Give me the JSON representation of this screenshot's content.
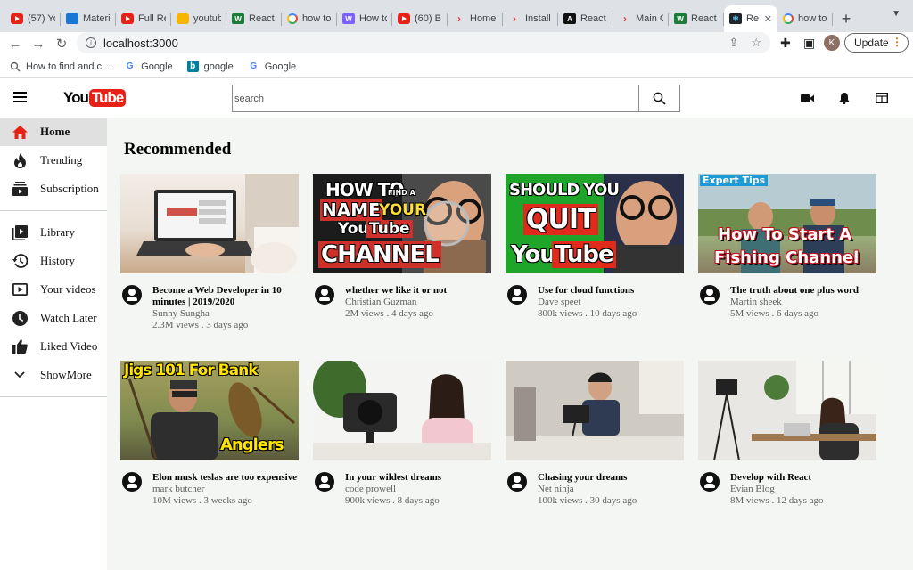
{
  "browser": {
    "tabs": [
      {
        "label": "(57) Yo",
        "icon": "youtube-favicon"
      },
      {
        "label": "Materi",
        "icon": "mui-favicon"
      },
      {
        "label": "Full Re",
        "icon": "youtube-favicon"
      },
      {
        "label": "youtub",
        "icon": "xyz-favicon"
      },
      {
        "label": "React",
        "icon": "w3-favicon"
      },
      {
        "label": "how to",
        "icon": "google-favicon"
      },
      {
        "label": "How to",
        "icon": "how-favicon"
      },
      {
        "label": "(60) B",
        "icon": "youtube-favicon"
      },
      {
        "label": "Home",
        "icon": "arrow-favicon"
      },
      {
        "label": "Install",
        "icon": "arrow-favicon"
      },
      {
        "label": "React",
        "icon": "dark-favicon"
      },
      {
        "label": "Main C",
        "icon": "arrow-favicon"
      },
      {
        "label": "React",
        "icon": "w3-favicon"
      },
      {
        "label": "Re",
        "icon": "react-favicon",
        "active": true
      },
      {
        "label": "how to",
        "icon": "google-favicon"
      }
    ],
    "url": "localhost:3000",
    "update_label": "Update",
    "profile_initial": "K",
    "bookmarks": [
      {
        "label": "How to find and c...",
        "icon": "search-icon"
      },
      {
        "label": "Google",
        "icon": "google-icon"
      },
      {
        "label": "google",
        "icon": "bing-icon"
      },
      {
        "label": "Google",
        "icon": "google-icon"
      }
    ]
  },
  "header": {
    "logo_you": "You",
    "logo_tube": "Tube",
    "search_placeholder": "search"
  },
  "sidebar": {
    "items": [
      {
        "label": "Home",
        "icon": "home-icon",
        "active": true
      },
      {
        "label": "Trending",
        "icon": "flame-icon"
      },
      {
        "label": "Subscription",
        "icon": "subscriptions-icon"
      },
      {
        "label": "Library",
        "icon": "library-icon"
      },
      {
        "label": "History",
        "icon": "history-icon"
      },
      {
        "label": "Your videos",
        "icon": "your-videos-icon"
      },
      {
        "label": "Watch Later",
        "icon": "watch-later-icon"
      },
      {
        "label": "Liked Video",
        "icon": "thumb-up-icon"
      },
      {
        "label": "ShowMore",
        "icon": "chevron-down-icon"
      }
    ]
  },
  "main": {
    "heading": "Recommended",
    "videos": [
      {
        "title": "Become a Web Developer in 10 minutes | 2019/2020",
        "channel": "Sunny Sungha",
        "stats": "2.3M views . 3 days ago"
      },
      {
        "title": "whether we like it or not",
        "channel": "Christian Guzman",
        "stats": "2M views . 4 days ago",
        "thumb_text": [
          "HOW TO",
          "FIND A",
          "NAME",
          "YOUR",
          "You",
          "Tube",
          "CHANNEL"
        ]
      },
      {
        "title": "Use for cloud functions",
        "channel": "Dave speet",
        "stats": "800k views . 10 days ago",
        "thumb_text": [
          "SHOULD YOU",
          "QUIT",
          "You",
          "Tube"
        ]
      },
      {
        "title": "The truth about one plus word",
        "channel": "Martin sheek",
        "stats": "5M views . 6 days ago",
        "thumb_text": [
          "Expert Tips",
          "How To Start A",
          "Fishing Channel"
        ]
      },
      {
        "title": "Elon musk teslas are too expensive",
        "channel": "mark butcher",
        "stats": "10M views . 3 weeks ago",
        "thumb_text": [
          "Jigs 101 For Bank",
          "Anglers"
        ]
      },
      {
        "title": "In your wildest dreams",
        "channel": "code prowell",
        "stats": "900k views . 8 days ago"
      },
      {
        "title": "Chasing your dreams",
        "channel": "Net ninja",
        "stats": "100k views . 30 days ago"
      },
      {
        "title": "Develop with React",
        "channel": "Evian Blog",
        "stats": "8M views . 12 days ago"
      }
    ]
  }
}
